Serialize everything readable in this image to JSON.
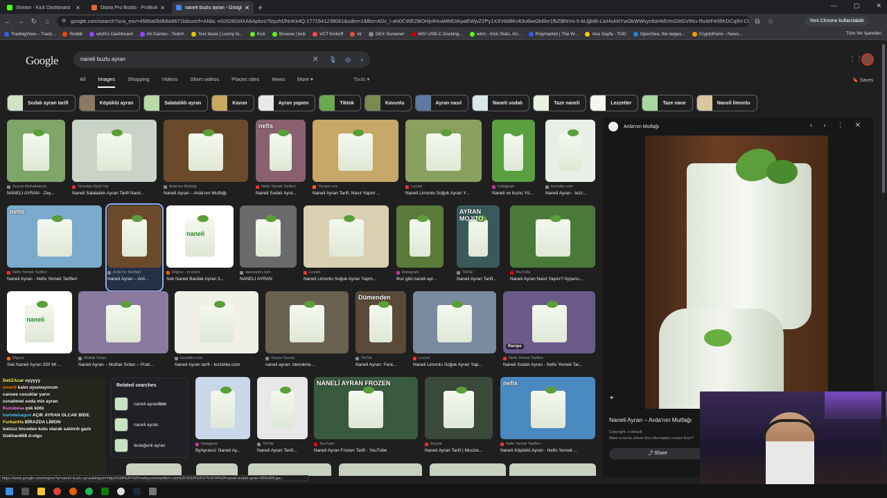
{
  "tabs": [
    {
      "title": "Stream - Kick Dashboard",
      "color": "#53fc18",
      "active": false
    },
    {
      "title": "Diana Pro Builds - ProBuilds.net",
      "color": "#e8623a",
      "active": false
    },
    {
      "title": "naneli buzlu ayran - Google Se",
      "color": "#4285f4",
      "active": true
    }
  ],
  "window_controls": {
    "minimize": "—",
    "maximize": "▢",
    "close": "✕"
  },
  "address": {
    "url": "google.com/search?sca_esv=4585a0b0b6a9671b&sxsrf=ANbL-n52G9GMXA6Apbvs7fzpzhDNnKk4Q:1771641238061&udm=2&fbs=ADc_l-aN0CWEZBOHjofHoaMMDiKpaEWjvZ2Py1XXV8d8Kvlt3o6iwGk6lvr1fbZlBNVs-5-bUjjb8li-LlxHsANYwOkWWsynltaHtdVmG5tGVRtu-l5sWF40fIKDCq9V-CLzH_5QiHYVBfJ2lGcoXIr...",
    "profile_chip": "Yeni Chrome kullanılabilir"
  },
  "bookmarks": [
    {
      "label": "TradingView – Track...",
      "color": "#2962ff"
    },
    {
      "label": "Reddit",
      "color": "#ff4500"
    },
    {
      "label": "wtcN's Dashboard",
      "color": "#9146ff"
    },
    {
      "label": "All Games - Twitch",
      "color": "#9146ff"
    },
    {
      "label": "Text faces | Lenny fa...",
      "color": "#f1c40f"
    },
    {
      "label": "Kick",
      "color": "#53fc18"
    },
    {
      "label": "Browse | kick",
      "color": "#53fc18"
    },
    {
      "label": "VCT Kickoff",
      "color": "#ff4655"
    },
    {
      "label": "vlr",
      "color": "#e74c3c"
    },
    {
      "label": "DEX Screener",
      "color": "#888888"
    },
    {
      "label": "MSI USB-C Docking...",
      "color": "#cc0000"
    },
    {
      "label": "wtcn - Kick Stats, An...",
      "color": "#53fc18"
    },
    {
      "label": "Polymarket | The W...",
      "color": "#2e5cff"
    },
    {
      "label": "Ana Sayfa - TOD",
      "color": "#ffcc00"
    },
    {
      "label": "OpenSea, the larges...",
      "color": "#2081e2"
    },
    {
      "label": "CryptoPanic - News...",
      "color": "#ff9900"
    }
  ],
  "all_bookmarks": "Tüm Yer İşaretleri",
  "google": {
    "logo": "Google",
    "query": "naneli buzlu ayran",
    "nav": [
      "All",
      "Images",
      "Shopping",
      "Videos",
      "Short videos",
      "Places sites",
      "News",
      "More ▾"
    ],
    "active_nav": "Images",
    "tools": "Tools ▾",
    "saves": "Saves"
  },
  "chips": [
    {
      "label": "Sodalı ayran tarifi",
      "color": "#cfe3c5"
    },
    {
      "label": "Köpüklü ayran",
      "color": "#8a7a60"
    },
    {
      "label": "Salatalıklı ayran",
      "color": "#b9d9a5"
    },
    {
      "label": "Kavun",
      "color": "#c9a860"
    },
    {
      "label": "Ayran yapımı",
      "color": "#e8e8e8"
    },
    {
      "label": "Tiktok",
      "color": "#6aa84f"
    },
    {
      "label": "Kavunlu",
      "color": "#7a8a50"
    },
    {
      "label": "Ayran nasıl",
      "color": "#5a7aa0"
    },
    {
      "label": "Naneli sodalı",
      "color": "#d8e8e8"
    },
    {
      "label": "Taze naneli",
      "color": "#e8f0e0"
    },
    {
      "label": "Lezzetler",
      "color": "#f4f8ee"
    },
    {
      "label": "Taze nane",
      "color": "#a8d8a0"
    },
    {
      "label": "Naneli limonlu",
      "color": "#d8c8a0"
    }
  ],
  "results": [
    {
      "source": "Zeynel Muhallebicisi",
      "caption": "NANELİ AYRAN - Zey...",
      "bg": "#7fa56a",
      "src_color": "#888"
    },
    {
      "source": "Yemekte Keyif Var",
      "caption": "Naneli Salatalıklı Ayran Tarifi Nasıl...",
      "bg": "#c9d3c8",
      "src_color": "#d33"
    },
    {
      "source": "Arda'nın Mutfağı",
      "caption": "Naneli Ayran – Arda'nın Mutfağı",
      "bg": "#6b4a2c",
      "src_color": "#888"
    },
    {
      "source": "Nefis Yemek Tarifleri",
      "caption": "Naneli Sodalı Ayra...",
      "bg": "#8a6070",
      "src_color": "#e33"
    },
    {
      "source": "Yemek.com",
      "caption": "Naneli Ayran Tarifi, Nasıl Yapılır ...",
      "bg": "#c8a868",
      "src_color": "#f60"
    },
    {
      "source": "Lezzet",
      "caption": "Naneli Limonlu Soğuk Ayran Y...",
      "bg": "#8aa060",
      "src_color": "#e33"
    },
    {
      "source": "Instagram",
      "caption": "Naneli ve buzlu Yö...",
      "bg": "#5aa040",
      "src_color": "#c39"
    },
    {
      "source": "lezzetler.com",
      "caption": "Naneli Ayran - lezz...",
      "bg": "#e8efe6",
      "src_color": "#888"
    },
    {
      "source": "Nefis Yemek Tarifleri",
      "caption": "Naneli Ayran - Nefis Yemek Tarifleri",
      "bg": "#7aaacc",
      "src_color": "#e33"
    },
    {
      "source": "Arda'nın Mutfağı",
      "caption": "Naneli Ayran – Ard...",
      "bg": "#6b4a2c",
      "src_color": "#888"
    },
    {
      "source": "Migros · In stock",
      "caption": "Sek Naneli Bardak Ayran 3...",
      "bg": "#ffffff",
      "src_color": "#f60"
    },
    {
      "source": "www.qrlim.com",
      "caption": "NANELİ AYRAN",
      "bg": "#6a6a6a",
      "src_color": "#888"
    },
    {
      "source": "Lezzet",
      "caption": "Naneli Limonlu Soğuk Ayran Yapm...",
      "bg": "#d8d0b0",
      "src_color": "#e33"
    },
    {
      "source": "Instagram",
      "caption": "Buz gibi naneli ayr...",
      "bg": "#5a7a3a",
      "src_color": "#c39"
    },
    {
      "source": "TikTok",
      "caption": "Naneli Ayran Tarifi...",
      "bg": "#3a5a5a",
      "src_color": "#888"
    },
    {
      "source": "YouTube",
      "caption": "Naneli Ayran Nasıl Yapılır? Ayşenu...",
      "bg": "#4a7a3a",
      "src_color": "#f00"
    },
    {
      "source": "Migros",
      "caption": "Sek Naneli Ayran 330 Ml ...",
      "bg": "#ffffff",
      "src_color": "#f60"
    },
    {
      "source": "Mutfak Sırları",
      "caption": "Naneli Ayran – Mutfak Sırları – Prati...",
      "bg": "#8a7aa0",
      "src_color": "#888"
    },
    {
      "source": "lezzetler.com",
      "caption": "Naneli Ayran tarifi - lezzetler.com",
      "bg": "#f0f0e8",
      "src_color": "#888"
    },
    {
      "source": "Vizyon Sarma",
      "caption": "naneli ayran: blenderla ...",
      "bg": "#6a6050",
      "src_color": "#888"
    },
    {
      "source": "TikTok",
      "caption": "Naneli Ayran: Fera...",
      "bg": "#5a4a3a",
      "src_color": "#888"
    },
    {
      "source": "Lezzet",
      "caption": "Naneli Limonlu Soğuk Ayran Yap...",
      "bg": "#7a8aa0",
      "src_color": "#e33"
    },
    {
      "source": "Nefis Yemek Tarifleri",
      "caption": "Naneli Sodalı Ayran - Nefis Yemek Tar...",
      "bg": "#6a5a8a",
      "src_color": "#e33"
    },
    {
      "source": "Instagram",
      "caption": "ByAyranci: Naneli Ay...",
      "bg": "#c8d8e8",
      "src_color": "#c39"
    },
    {
      "source": "TikTok",
      "caption": "Naneli Ayran Tarifi...",
      "bg": "#e8e8e8",
      "src_color": "#888"
    },
    {
      "source": "YouTube",
      "caption": "Naneli Ayran Frozen Tarifi - YouTube",
      "bg": "#3a5a40",
      "src_color": "#f00"
    },
    {
      "source": "Arçelik",
      "caption": "Naneli Ayran Tarifi | Mucize...",
      "bg": "#3a4a3a",
      "src_color": "#d33"
    },
    {
      "source": "Nefis Yemek Tarifleri",
      "caption": "Naneli Köpüklü Ayran - Nefis Yemek ...",
      "bg": "#4a8ac0",
      "src_color": "#e33"
    }
  ],
  "overlay_texts": {
    "nefis": "nefis",
    "mojito": "AYRAN MOJITO",
    "dumenden": "Dümenden",
    "frozen": "NANELİ AYRAN FROZEN",
    "naneli_cup": "naneli",
    "ayran_cup": "AYRAN",
    "recipe": "Recipe"
  },
  "related": {
    "title": "Related searches",
    "items": [
      {
        "prefix": "naneli ayran ",
        "bold": "bim"
      },
      {
        "prefix": "naneli ayran",
        "bold": ""
      },
      {
        "prefix": "fesleğenli ayran",
        "bold": ""
      }
    ]
  },
  "chat": [
    {
      "user": "DeliZAcar",
      "msg": " oyyyyy",
      "color": "#ff5"
    },
    {
      "user": "omerb",
      "msg": " kalın uyumuyorum",
      "color": "#f80"
    },
    {
      "user": "cansee",
      "msg": " cocuklar yarın",
      "color": "#fff"
    },
    {
      "user": "ccnahmet",
      "msg": " soda mix ayran",
      "color": "#fff"
    },
    {
      "user": "Kuzubesa",
      "msg": " çok kötü",
      "color": "#f8f"
    },
    {
      "user": "barbdahagun",
      "msg": " AÇIK AYRAN OLCAK BİDE",
      "color": "#5cf"
    },
    {
      "user": "FurkanHa",
      "msg": " BİRAZDA LİMON",
      "color": "#fe5"
    },
    {
      "user": "luelzzz",
      "msg": " önceden kutu olarak satılırdı gazlı",
      "color": "#fff"
    },
    {
      "user": "Gokhan658",
      "msg": " d-olgu",
      "color": "#fff"
    }
  ],
  "viewer": {
    "site": "Arda'nın Mutfağı",
    "title": "Naneli Ayran – Arda'nın Mutfağı",
    "copyright": "Copyright: x-default",
    "want": "Want to know where this information comes from?",
    "share": "Share"
  },
  "status_url": "https://www.google.com/imgres?q=naneli buzlu ayran&imgurl=https%3A%2F%2Fnefisyemektarifleri.com%2F2016%2F07%2F04%2Fnaneli-sodali-ayran-600x400.jpe..."
}
